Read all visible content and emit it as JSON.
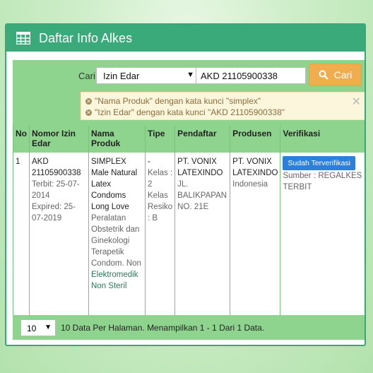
{
  "header": {
    "title": "Daftar Info Alkes",
    "icon": "table-grid-icon"
  },
  "search": {
    "label": "Cari",
    "field_selected": "Izin Edar",
    "query_value": "AKD 21105900338",
    "button_label": "Cari"
  },
  "filters": [
    "\"Nama Produk\" dengan kata kunci \"simplex\"",
    "\"Izin Edar\" dengan kata kunci \"AKD 21105900338\""
  ],
  "table": {
    "headers": [
      "No",
      "Nomor Izin Edar",
      "Nama Produk",
      "Tipe",
      "Pendaftar",
      "Produsen",
      "Verifikasi"
    ],
    "rows": [
      {
        "no": "1",
        "nomor": "AKD 21105900338",
        "terbit": "Terbit: 25-07-2014",
        "expired": "Expired: 25-07-2019",
        "nama": "SIMPLEX Male Natural Latex Condoms Long Love",
        "kategori": "Peralatan Obstetrik dan Ginekologi Terapetik Condom. Non",
        "elektromedik": "Elektromedik",
        "steril": "Non Steril",
        "tipe_dash": "-",
        "tipe": "Kelas : 2 Kelas Resiko : B",
        "pendaftar": "PT. VONIX LATEXINDO",
        "pendaftar_alamat": "JL. BALIKPAPAN NO. 21E",
        "produsen": "PT. VONIX LATEXINDO",
        "produsen_negara": "Indonesia",
        "verifikasi": "Sudah Terverifikasi",
        "sumber": "Sumber : REGALKES TERBIT"
      }
    ]
  },
  "footer": {
    "page_size": "10",
    "summary": "10 Data Per Halaman. Menampilkan 1 - 1 Dari 1 Data."
  },
  "colors": {
    "header_bg": "#3aaa7a",
    "section_bg": "#8fd48e",
    "button_bg": "#f0ad4e",
    "badge_bg": "#2e7fdc"
  }
}
